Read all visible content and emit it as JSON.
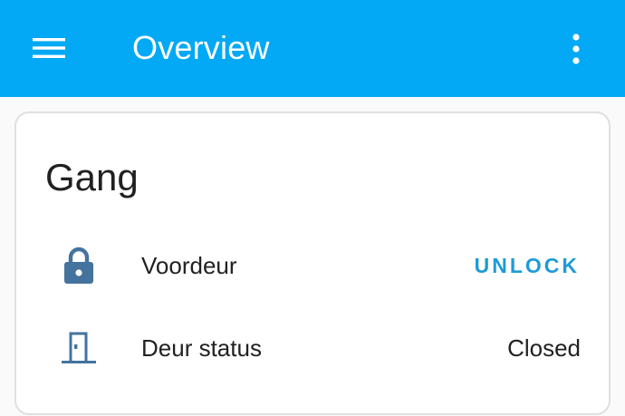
{
  "header": {
    "title": "Overview"
  },
  "card": {
    "title": "Gang",
    "entities": [
      {
        "name": "Voordeur",
        "icon": "lock-icon",
        "action_label": "UNLOCK"
      },
      {
        "name": "Deur status",
        "icon": "door-closed-icon",
        "state": "Closed"
      }
    ]
  },
  "colors": {
    "header_bg": "#03a9f4",
    "icon": "#44739e",
    "action": "#1e9bd8"
  }
}
